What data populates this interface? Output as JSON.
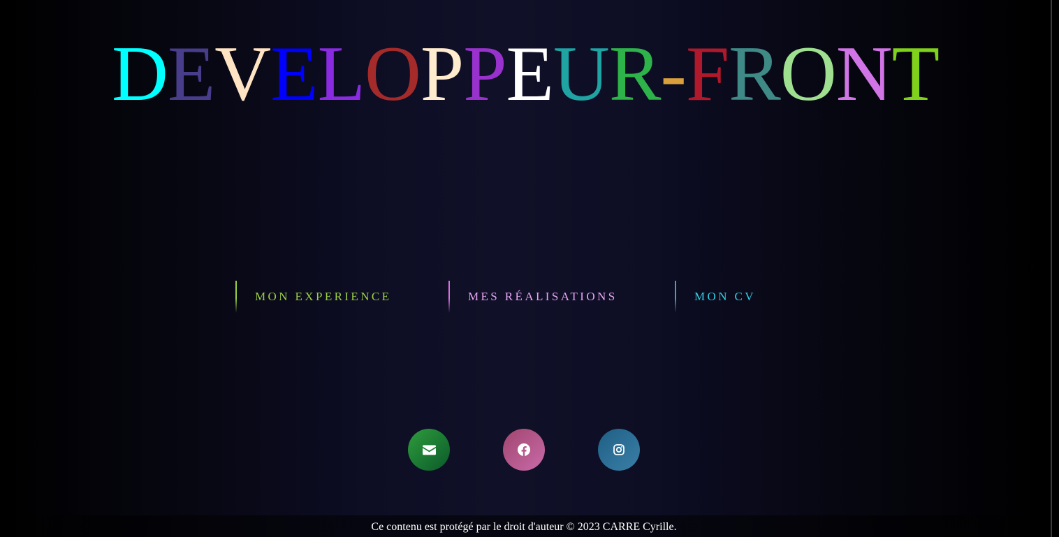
{
  "header": {
    "title_letters": [
      {
        "char": "D",
        "color": "#00ffff"
      },
      {
        "char": "E",
        "color": "#483d8b"
      },
      {
        "char": "V",
        "color": "#ffe4c4"
      },
      {
        "char": "E",
        "color": "#0000ff"
      },
      {
        "char": "L",
        "color": "#8a2be2"
      },
      {
        "char": "O",
        "color": "#a52a2a"
      },
      {
        "char": "P",
        "color": "#ffebcd"
      },
      {
        "char": "P",
        "color": "#9932cc"
      },
      {
        "char": "E",
        "color": "#ffffff"
      },
      {
        "char": "U",
        "color": "#20a3a3"
      },
      {
        "char": "R",
        "color": "#2eb24a"
      },
      {
        "char": "-",
        "color": "#daa03b"
      },
      {
        "char": "F",
        "color": "#b0182c"
      },
      {
        "char": "R",
        "color": "#3f8a86"
      },
      {
        "char": "O",
        "color": "#9ee08f"
      },
      {
        "char": "N",
        "color": "#d175e6"
      },
      {
        "char": "T",
        "color": "#7fd11b"
      }
    ]
  },
  "nav": {
    "items": [
      {
        "label": "MON EXPERIENCE",
        "color": "#9ccf42",
        "bar_color": "#9ccf42"
      },
      {
        "label": "MES RÉALISATIONS",
        "color": "#e9a6f4",
        "bar_color": "#d86fe0"
      },
      {
        "label": "MON CV",
        "color": "#32cde2",
        "bar_color": "#2aaec0"
      }
    ]
  },
  "socials": [
    {
      "icon": "envelope-icon",
      "gradient": [
        "#2e9c3c",
        "#0b5a2a"
      ]
    },
    {
      "icon": "facebook-icon",
      "gradient": [
        "#a0466f",
        "#c96aa8"
      ]
    },
    {
      "icon": "instagram-icon",
      "gradient": [
        "#1f5f84",
        "#3a7fa8"
      ]
    }
  ],
  "footer": {
    "text": "Ce contenu est protégé par le droit d'auteur © 2023 CARRE Cyrille."
  }
}
